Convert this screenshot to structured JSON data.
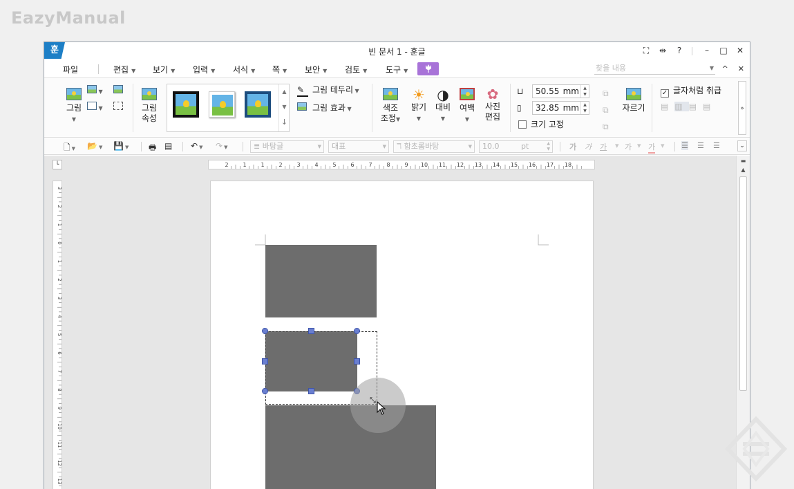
{
  "watermark": {
    "text": "EazyManual"
  },
  "window": {
    "logo": "훈",
    "title": "빈 문서 1 - 훈글",
    "controls": [
      "⛶",
      "⇹",
      "?",
      "–",
      "□",
      "✕"
    ]
  },
  "menu": {
    "items": [
      {
        "label": "파일",
        "dropdown": false
      },
      {
        "label": "편집",
        "dropdown": true
      },
      {
        "label": "보기",
        "dropdown": true
      },
      {
        "label": "입력",
        "dropdown": true
      },
      {
        "label": "서식",
        "dropdown": true
      },
      {
        "label": "쪽",
        "dropdown": true
      },
      {
        "label": "보안",
        "dropdown": true
      },
      {
        "label": "검토",
        "dropdown": true
      },
      {
        "label": "도구",
        "dropdown": true
      }
    ],
    "special_icon": "tulip-icon",
    "search_placeholder": "찾을 내용",
    "right_controls": [
      "^",
      "✕"
    ]
  },
  "ribbon": {
    "picture": "그림",
    "picture_props": [
      "그림",
      "속성"
    ],
    "border": "그림 테두리",
    "effect": "그림 효과",
    "color_adjust": [
      "색조",
      "조정"
    ],
    "brightness": "밝기",
    "contrast": "대비",
    "margin": "여백",
    "photo_edit": [
      "사진",
      "편집"
    ],
    "width_value": "50.55",
    "height_value": "32.85",
    "unit": "mm",
    "fix_size": "크기 고정",
    "fix_size_checked": false,
    "crop": "자르기",
    "as_char": "글자처럼 취급",
    "as_char_checked": true,
    "expand": "»"
  },
  "toolbar2": {
    "style": "바탕글",
    "lang": "대표",
    "font": "함초롬바탕",
    "size": "10.0",
    "size_unit": "pt",
    "char_buttons": [
      "가",
      "가",
      "가",
      "가",
      "가"
    ]
  },
  "ruler": {
    "h_labels": [
      "2",
      "1",
      "1",
      "2",
      "3",
      "4",
      "5",
      "6",
      "7",
      "8",
      "9",
      "10",
      "11",
      "12",
      "13",
      "14",
      "15",
      "16",
      "17",
      "18"
    ],
    "v_labels": [
      "3",
      "2",
      "1",
      "0",
      "1",
      "2",
      "3",
      "4",
      "5",
      "6",
      "7",
      "8",
      "9",
      "10",
      "11",
      "12",
      "13"
    ]
  },
  "colors": {
    "accent": "#1d7fc6",
    "menu_special": "#a873d8",
    "shape": "#6d6d6d",
    "handle": "#6a7fd0"
  }
}
